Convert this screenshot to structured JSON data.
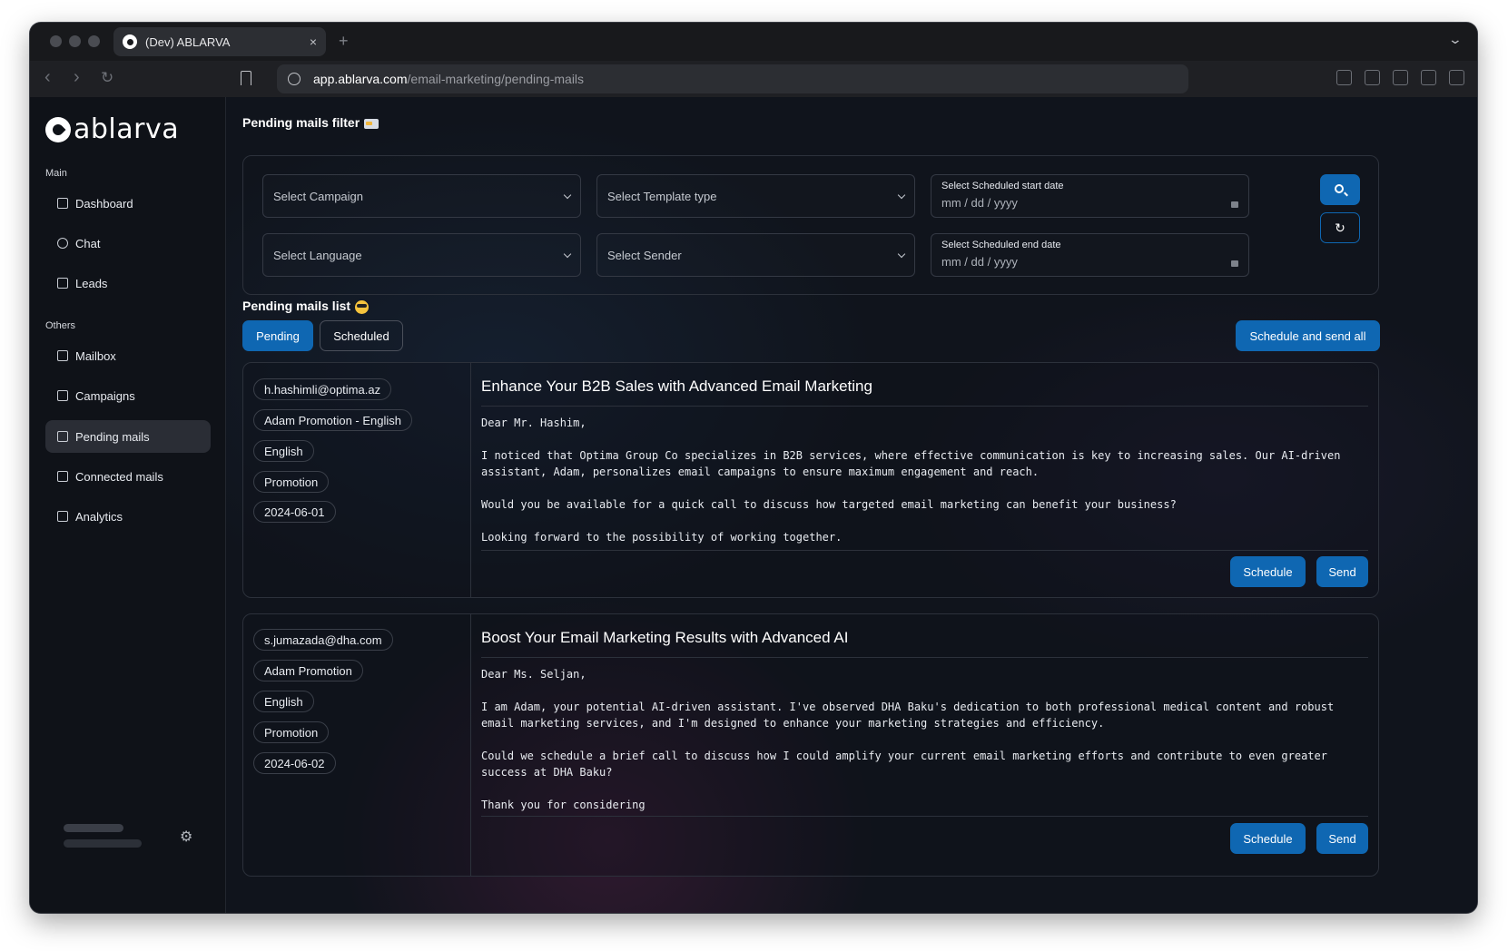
{
  "browser": {
    "tab_title": "(Dev) ABLARVA",
    "new_tab": "+",
    "close": "×",
    "url_host": "app.ablarva.com",
    "url_path": "/email-marketing/pending-mails"
  },
  "sidebar": {
    "logo": "ablarva",
    "main_label": "Main",
    "others_label": "Others",
    "main_items": [
      {
        "label": "Dashboard",
        "icon": "grid-icon"
      },
      {
        "label": "Chat",
        "icon": "chat-bubble-icon"
      },
      {
        "label": "Leads",
        "icon": "bar-chart-icon"
      }
    ],
    "other_items": [
      {
        "label": "Mailbox",
        "icon": "mailbox-icon"
      },
      {
        "label": "Campaigns",
        "icon": "megaphone-icon"
      },
      {
        "label": "Pending mails",
        "icon": "envelope-icon",
        "active": true
      },
      {
        "label": "Connected mails",
        "icon": "envelope-link-icon"
      },
      {
        "label": "Analytics",
        "icon": "analytics-icon"
      }
    ]
  },
  "filter": {
    "title": "Pending mails filter",
    "campaign_placeholder": "Select Campaign",
    "template_placeholder": "Select Template type",
    "language_placeholder": "Select Language",
    "sender_placeholder": "Select Sender",
    "start_date_label": "Select Scheduled start date",
    "end_date_label": "Select Scheduled end date",
    "date_mm": "mm",
    "date_dd": "dd",
    "date_yyyy": "yyyy",
    "date_sep": "/"
  },
  "list": {
    "title": "Pending mails list",
    "tab_pending": "Pending",
    "tab_scheduled": "Scheduled",
    "schedule_all": "Schedule and send all"
  },
  "mails": [
    {
      "email": "h.hashimli@optima.az",
      "campaign": "Adam Promotion - English",
      "language": "English",
      "type": "Promotion",
      "date": "2024-06-01",
      "subject": "Enhance Your B2B Sales with Advanced Email Marketing",
      "body": [
        "Dear Mr. Hashim,",
        "I noticed that Optima Group Co specializes in B2B services, where effective communication is key to increasing sales. Our AI-driven assistant, Adam, personalizes email campaigns to ensure maximum engagement and reach.",
        "Would you be available for a quick call to discuss how targeted email marketing can benefit your business?",
        "Looking forward to the possibility of working together."
      ],
      "schedule": "Schedule",
      "send": "Send"
    },
    {
      "email": "s.jumazada@dha.com",
      "campaign": "Adam Promotion",
      "language": "English",
      "type": "Promotion",
      "date": "2024-06-02",
      "subject": "Boost Your Email Marketing Results with Advanced AI",
      "body": [
        "Dear Ms. Seljan,",
        "I am Adam, your potential AI-driven assistant. I've observed DHA Baku's dedication to both professional medical content and robust email marketing services, and I'm designed to enhance your marketing strategies and efficiency.",
        "Could we schedule a brief call to discuss how I could amplify your current email marketing efforts and contribute to even greater success at DHA Baku?",
        "Thank you for considering"
      ],
      "schedule": "Schedule",
      "send": "Send"
    }
  ],
  "colors": {
    "accent": "#0f67b2",
    "background": "#10141c",
    "sidebar": "#0f1218"
  }
}
